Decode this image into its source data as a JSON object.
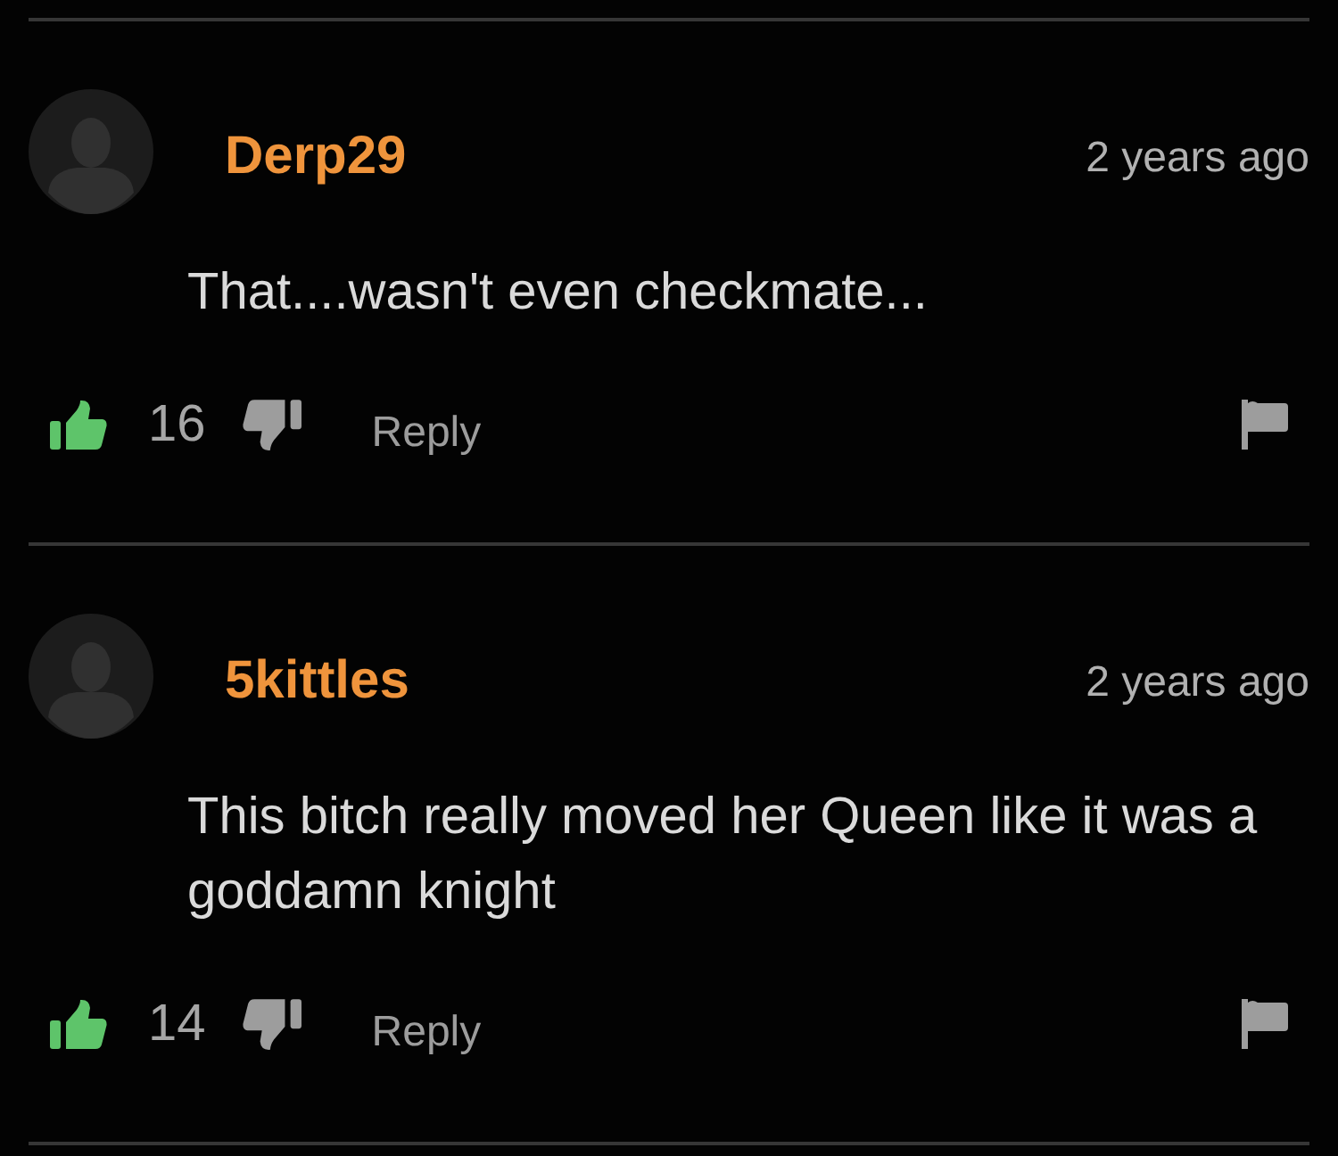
{
  "comments": [
    {
      "username": "Derp29",
      "time": "2 years ago",
      "text": "That....wasn't even checkmate...",
      "likes": "16",
      "reply": "Reply"
    },
    {
      "username": "5kittles",
      "time": "2 years ago",
      "text": "This bitch really moved her Queen like it was a goddamn knight",
      "likes": "14",
      "reply": "Reply"
    }
  ]
}
